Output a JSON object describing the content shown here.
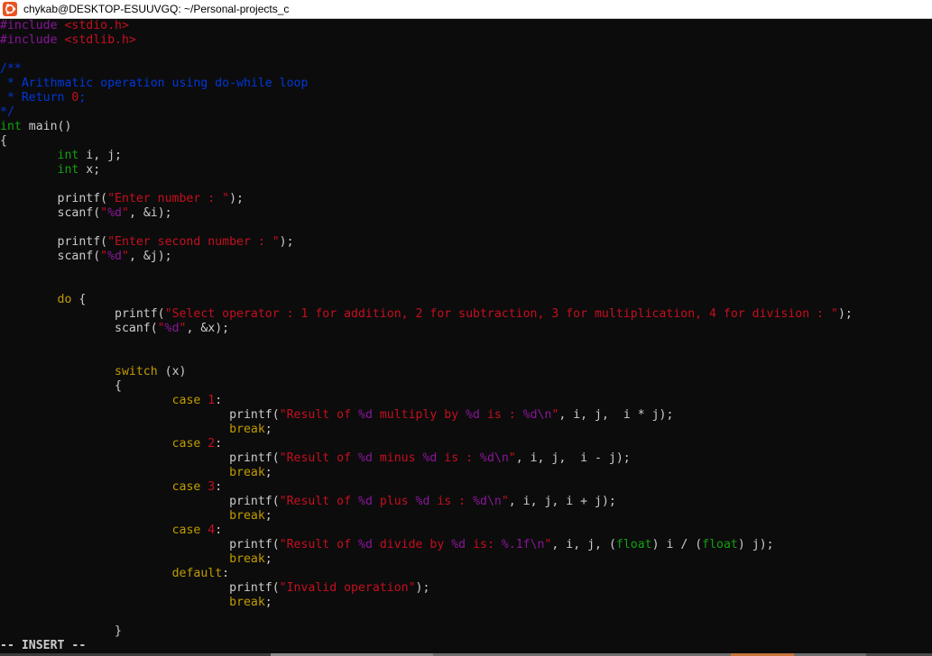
{
  "window": {
    "title": "chykab@DESKTOP-ESUUVGQ: ~/Personal-projects_c",
    "icon": "ubuntu-icon"
  },
  "colors": {
    "background": "#0c0c0c",
    "default": "#cccccc",
    "preprocessor": "#881798",
    "header": "#c50f1f",
    "comment": "#0037da",
    "type": "#13a10e",
    "string": "#c50f1f",
    "format": "#881798",
    "keyword": "#c19c00",
    "number": "#c50f1f"
  },
  "code_lines": [
    [
      [
        "pre",
        "#include "
      ],
      [
        "hdr",
        "<stdio.h>"
      ]
    ],
    [
      [
        "pre",
        "#include "
      ],
      [
        "hdr",
        "<stdlib.h>"
      ]
    ],
    [],
    [
      [
        "cmt",
        "/**"
      ]
    ],
    [
      [
        "cmt",
        " * Arithmatic operation using do-while loop"
      ]
    ],
    [
      [
        "cmt",
        " * Return "
      ],
      [
        "cnum",
        "0"
      ],
      [
        "cmt",
        ";"
      ]
    ],
    [
      [
        "cmt",
        "*/"
      ]
    ],
    [
      [
        "type",
        "int"
      ],
      [
        "txt",
        " main()"
      ]
    ],
    [
      [
        "txt",
        "{"
      ]
    ],
    [
      [
        "txt",
        "        "
      ],
      [
        "type",
        "int"
      ],
      [
        "txt",
        " i, j;"
      ]
    ],
    [
      [
        "txt",
        "        "
      ],
      [
        "type",
        "int"
      ],
      [
        "txt",
        " x;"
      ]
    ],
    [],
    [
      [
        "txt",
        "        printf("
      ],
      [
        "str",
        "\"Enter number : \""
      ],
      [
        "txt",
        ");"
      ]
    ],
    [
      [
        "txt",
        "        scanf("
      ],
      [
        "str",
        "\""
      ],
      [
        "fmt",
        "%d"
      ],
      [
        "str",
        "\""
      ],
      [
        "txt",
        ", &i);"
      ]
    ],
    [],
    [
      [
        "txt",
        "        printf("
      ],
      [
        "str",
        "\"Enter second number : \""
      ],
      [
        "txt",
        ");"
      ]
    ],
    [
      [
        "txt",
        "        scanf("
      ],
      [
        "str",
        "\""
      ],
      [
        "fmt",
        "%d"
      ],
      [
        "str",
        "\""
      ],
      [
        "txt",
        ", &j);"
      ]
    ],
    [],
    [],
    [
      [
        "txt",
        "        "
      ],
      [
        "kw",
        "do"
      ],
      [
        "txt",
        " {"
      ]
    ],
    [
      [
        "txt",
        "                printf("
      ],
      [
        "str",
        "\"Select operator : 1 for addition, 2 for subtraction, 3 for multiplication, 4 for division : \""
      ],
      [
        "txt",
        ");"
      ]
    ],
    [
      [
        "txt",
        "                scanf("
      ],
      [
        "str",
        "\""
      ],
      [
        "fmt",
        "%d"
      ],
      [
        "str",
        "\""
      ],
      [
        "txt",
        ", &x);"
      ]
    ],
    [],
    [],
    [
      [
        "txt",
        "                "
      ],
      [
        "kw",
        "switch"
      ],
      [
        "txt",
        " (x)"
      ]
    ],
    [
      [
        "txt",
        "                {"
      ]
    ],
    [
      [
        "txt",
        "                        "
      ],
      [
        "kw",
        "case"
      ],
      [
        "txt",
        " "
      ],
      [
        "num",
        "1"
      ],
      [
        "txt",
        ":"
      ]
    ],
    [
      [
        "txt",
        "                                printf("
      ],
      [
        "str",
        "\"Result of "
      ],
      [
        "fmt",
        "%d"
      ],
      [
        "str",
        " multiply by "
      ],
      [
        "fmt",
        "%d"
      ],
      [
        "str",
        " is : "
      ],
      [
        "fmt",
        "%d\\n"
      ],
      [
        "str",
        "\""
      ],
      [
        "txt",
        ", i, j,  i * j);"
      ]
    ],
    [
      [
        "txt",
        "                                "
      ],
      [
        "kw",
        "break"
      ],
      [
        "txt",
        ";"
      ]
    ],
    [
      [
        "txt",
        "                        "
      ],
      [
        "kw",
        "case"
      ],
      [
        "txt",
        " "
      ],
      [
        "num",
        "2"
      ],
      [
        "txt",
        ":"
      ]
    ],
    [
      [
        "txt",
        "                                printf("
      ],
      [
        "str",
        "\"Result of "
      ],
      [
        "fmt",
        "%d"
      ],
      [
        "str",
        " minus "
      ],
      [
        "fmt",
        "%d"
      ],
      [
        "str",
        " is : "
      ],
      [
        "fmt",
        "%d\\n"
      ],
      [
        "str",
        "\""
      ],
      [
        "txt",
        ", i, j,  i - j);"
      ]
    ],
    [
      [
        "txt",
        "                                "
      ],
      [
        "kw",
        "break"
      ],
      [
        "txt",
        ";"
      ]
    ],
    [
      [
        "txt",
        "                        "
      ],
      [
        "kw",
        "case"
      ],
      [
        "txt",
        " "
      ],
      [
        "num",
        "3"
      ],
      [
        "txt",
        ":"
      ]
    ],
    [
      [
        "txt",
        "                                printf("
      ],
      [
        "str",
        "\"Result of "
      ],
      [
        "fmt",
        "%d"
      ],
      [
        "str",
        " plus "
      ],
      [
        "fmt",
        "%d"
      ],
      [
        "str",
        " is : "
      ],
      [
        "fmt",
        "%d\\n"
      ],
      [
        "str",
        "\""
      ],
      [
        "txt",
        ", i, j, i + j);"
      ]
    ],
    [
      [
        "txt",
        "                                "
      ],
      [
        "kw",
        "break"
      ],
      [
        "txt",
        ";"
      ]
    ],
    [
      [
        "txt",
        "                        "
      ],
      [
        "kw",
        "case"
      ],
      [
        "txt",
        " "
      ],
      [
        "num",
        "4"
      ],
      [
        "txt",
        ":"
      ]
    ],
    [
      [
        "txt",
        "                                printf("
      ],
      [
        "str",
        "\"Result of "
      ],
      [
        "fmt",
        "%d"
      ],
      [
        "str",
        " divide by "
      ],
      [
        "fmt",
        "%d"
      ],
      [
        "str",
        " is: "
      ],
      [
        "fmt",
        "%.1f\\n"
      ],
      [
        "str",
        "\""
      ],
      [
        "txt",
        ", i, j, ("
      ],
      [
        "type",
        "float"
      ],
      [
        "txt",
        ") i / ("
      ],
      [
        "type",
        "float"
      ],
      [
        "txt",
        ") j);"
      ]
    ],
    [
      [
        "txt",
        "                                "
      ],
      [
        "kw",
        "break"
      ],
      [
        "txt",
        ";"
      ]
    ],
    [
      [
        "txt",
        "                        "
      ],
      [
        "kw",
        "default"
      ],
      [
        "txt",
        ":"
      ]
    ],
    [
      [
        "txt",
        "                                printf("
      ],
      [
        "str",
        "\"Invalid operation\""
      ],
      [
        "txt",
        ");"
      ]
    ],
    [
      [
        "txt",
        "                                "
      ],
      [
        "kw",
        "break"
      ],
      [
        "txt",
        ";"
      ]
    ],
    [],
    [
      [
        "txt",
        "                }"
      ]
    ]
  ],
  "status": {
    "mode": "-- INSERT --"
  }
}
